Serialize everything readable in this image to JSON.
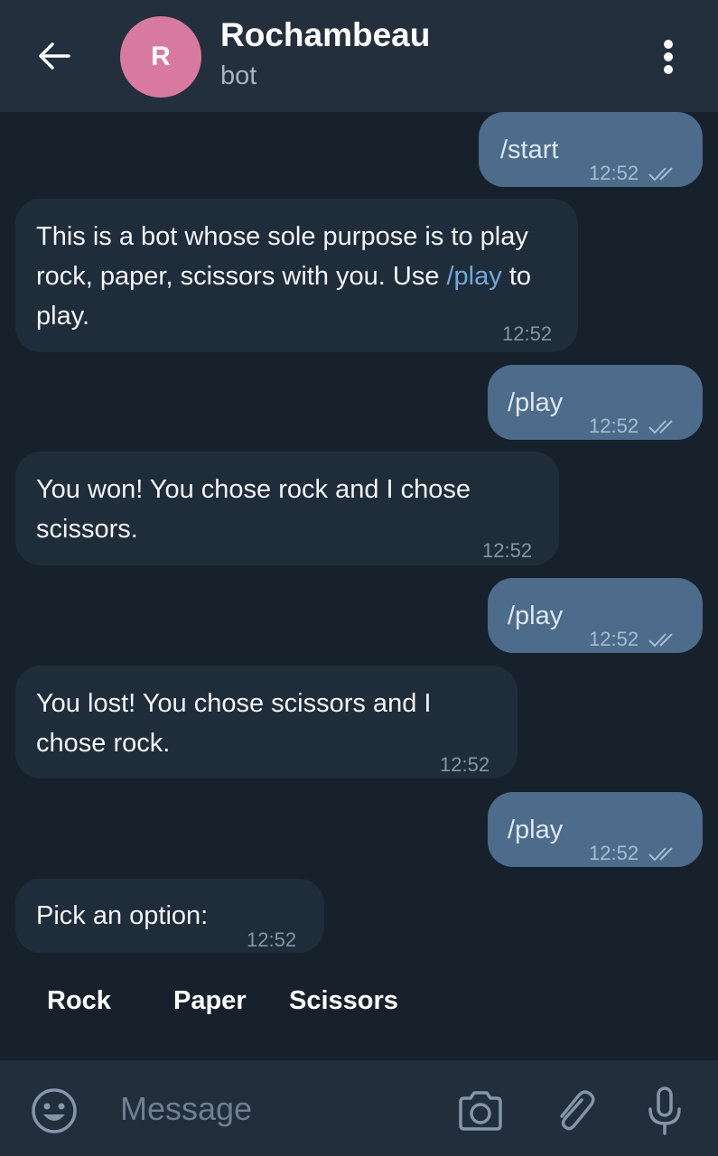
{
  "header": {
    "title": "Rochambeau",
    "subtitle": "bot",
    "avatar_letter": "R",
    "avatar_color": "#d87a9f"
  },
  "messages": [
    {
      "direction": "out",
      "text": "/start",
      "time": "12:52"
    },
    {
      "direction": "in",
      "text_before_link": "This is a bot whose sole purpose is to play rock, paper, scissors with you. Use ",
      "link": "/play",
      "text_after_link": " to play.",
      "time": "12:52"
    },
    {
      "direction": "out",
      "text": "/play",
      "time": "12:52"
    },
    {
      "direction": "in",
      "text": "You won! You chose rock and I chose scissors.",
      "time": "12:52"
    },
    {
      "direction": "out",
      "text": "/play",
      "time": "12:52"
    },
    {
      "direction": "in",
      "text": "You lost! You chose scissors and I chose rock.",
      "time": "12:52"
    },
    {
      "direction": "out",
      "text": "/play",
      "time": "12:52"
    },
    {
      "direction": "in",
      "text": "Pick an option:",
      "time": "12:52"
    }
  ],
  "keyboard": [
    "Rock",
    "Paper",
    "Scissors"
  ],
  "composer": {
    "placeholder": "Message",
    "icons": [
      "emoji-icon",
      "camera-icon",
      "attach-icon",
      "mic-icon"
    ]
  },
  "colors": {
    "background": "#17212b",
    "header": "#242f3d",
    "outgoing_bubble": "#4d6b8a",
    "incoming_bubble": "#1f2c3a",
    "link": "#6fa9d8"
  }
}
